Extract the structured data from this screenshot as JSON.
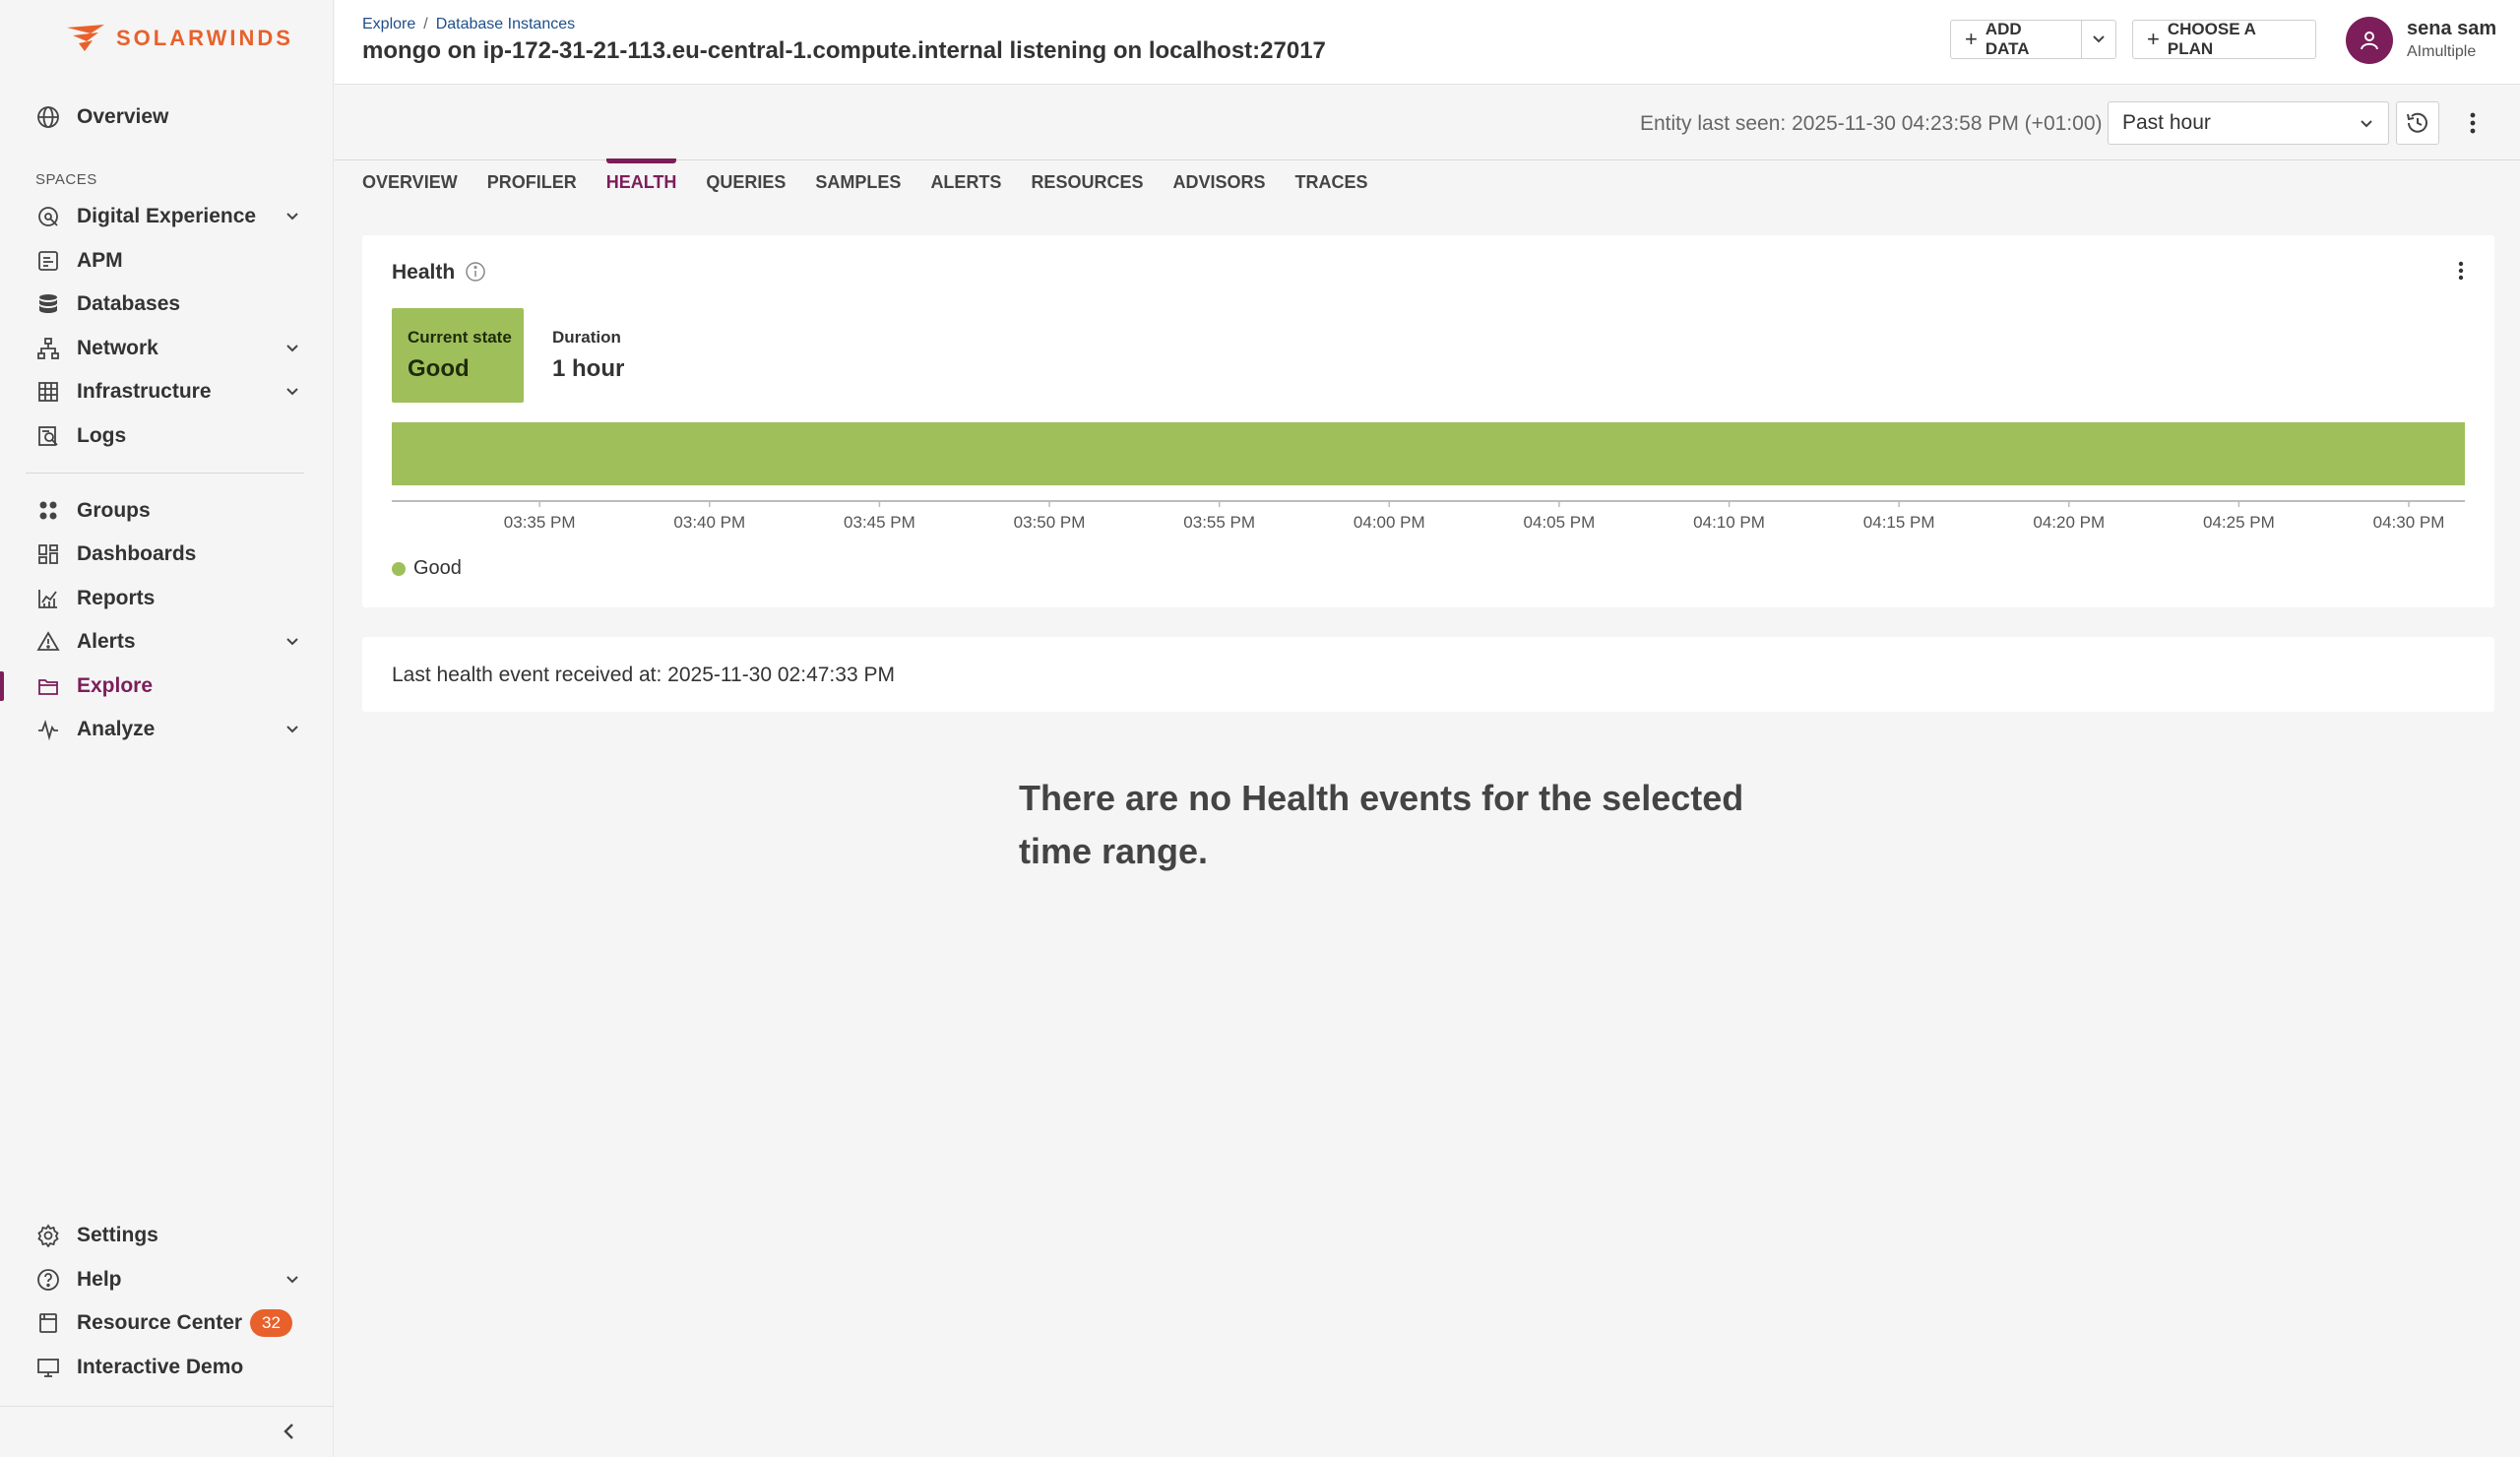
{
  "brand": {
    "logo_text": "SOLARWINDS",
    "accent": "#e8612c",
    "primary": "#7b1e5a"
  },
  "sidebar": {
    "overview": "Overview",
    "section_label": "SPACES",
    "items": [
      {
        "label": "Digital Experience",
        "icon": "digital-experience-icon",
        "has_chevron": true
      },
      {
        "label": "APM",
        "icon": "apm-icon",
        "has_chevron": false
      },
      {
        "label": "Databases",
        "icon": "database-icon",
        "has_chevron": false
      },
      {
        "label": "Network",
        "icon": "network-icon",
        "has_chevron": true
      },
      {
        "label": "Infrastructure",
        "icon": "grid-icon",
        "has_chevron": true
      },
      {
        "label": "Logs",
        "icon": "logs-icon",
        "has_chevron": false
      }
    ],
    "items2": [
      {
        "label": "Groups",
        "icon": "groups-icon",
        "has_chevron": false
      },
      {
        "label": "Dashboards",
        "icon": "dashboards-icon",
        "has_chevron": false
      },
      {
        "label": "Reports",
        "icon": "reports-icon",
        "has_chevron": false
      },
      {
        "label": "Alerts",
        "icon": "alert-icon",
        "has_chevron": true
      },
      {
        "label": "Explore",
        "icon": "folder-icon",
        "has_chevron": false,
        "active": true
      },
      {
        "label": "Analyze",
        "icon": "analyze-icon",
        "has_chevron": true
      }
    ],
    "bottom": [
      {
        "label": "Settings",
        "icon": "gear-icon",
        "has_chevron": false
      },
      {
        "label": "Help",
        "icon": "help-icon",
        "has_chevron": true
      },
      {
        "label": "Resource Center",
        "icon": "resource-center-icon",
        "badge": "32"
      },
      {
        "label": "Interactive Demo",
        "icon": "monitor-icon",
        "has_chevron": false
      }
    ]
  },
  "header": {
    "breadcrumb": [
      "Explore",
      "Database Instances"
    ],
    "breadcrumb_sep": "/",
    "title": "mongo on ip-172-31-21-113.eu-central-1.compute.internal listening on localhost:27017",
    "add_data": "ADD DATA",
    "choose_plan": "CHOOSE A PLAN",
    "user_name": "sena sam",
    "user_org": "AImultiple"
  },
  "toolbar": {
    "last_seen": "Entity last seen: 2025-11-30 04:23:58 PM (+01:00)",
    "time_range": "Past hour"
  },
  "tabs": [
    "OVERVIEW",
    "PROFILER",
    "HEALTH",
    "QUERIES",
    "SAMPLES",
    "ALERTS",
    "RESOURCES",
    "ADVISORS",
    "TRACES"
  ],
  "active_tab": "HEALTH",
  "health": {
    "title": "Health",
    "current_state_label": "Current state",
    "current_state_value": "Good",
    "duration_label": "Duration",
    "duration_value": "1 hour",
    "legend_label": "Good",
    "status_color": "#9fbf5b"
  },
  "chart_data": {
    "type": "area",
    "x_ticks": [
      "03:35 PM",
      "03:40 PM",
      "03:45 PM",
      "03:50 PM",
      "03:55 PM",
      "04:00 PM",
      "04:05 PM",
      "04:10 PM",
      "04:15 PM",
      "04:20 PM",
      "04:25 PM",
      "04:30 PM"
    ],
    "series": [
      {
        "name": "Good",
        "segments": [
          {
            "from": "03:31 PM",
            "to": "04:31 PM",
            "state": "Good"
          }
        ]
      }
    ],
    "legend_position": "bottom-left"
  },
  "last_event": "Last health event received at: 2025-11-30 02:47:33 PM",
  "empty_message": "There are no Health events for the selected time range."
}
